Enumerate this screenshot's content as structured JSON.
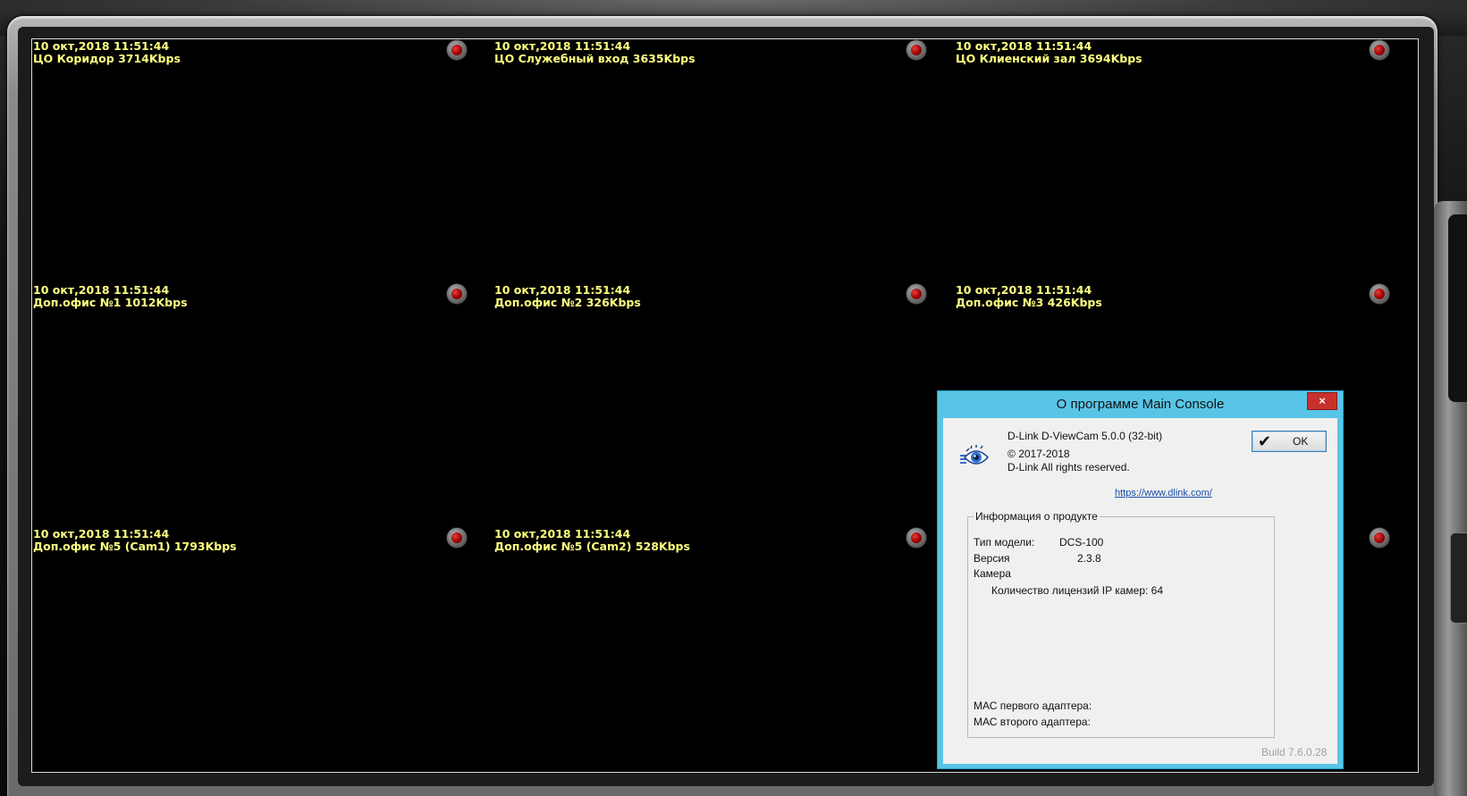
{
  "cameras": [
    {
      "datetime": "10 окт,2018 11:51:44",
      "name": "ЦО Коридор 3714Kbps"
    },
    {
      "datetime": "10 окт,2018 11:51:44",
      "name": "ЦО Служебный вход 3635Kbps"
    },
    {
      "datetime": "10 окт,2018 11:51:44",
      "name": "ЦО Клиенский зал 3694Kbps"
    },
    {
      "datetime": "10 окт,2018 11:51:44",
      "name": "Доп.офис №1 1012Kbps"
    },
    {
      "datetime": "10 окт,2018 11:51:44",
      "name": "Доп.офис №2 326Kbps"
    },
    {
      "datetime": "10 окт,2018 11:51:44",
      "name": "Доп.офис №3 426Kbps"
    },
    {
      "datetime": "10 окт,2018 11:51:44",
      "name": "Доп.офис №5 (Cam1) 1793Kbps"
    },
    {
      "datetime": "10 окт,2018 11:51:44",
      "name": "Доп.офис №5 (Cam2) 528Kbps"
    },
    {
      "datetime": "",
      "name": ""
    }
  ],
  "colors": {
    "overlay_text": "#ffff80",
    "dialog_frame": "#59c5e6",
    "close_button": "#c9302c",
    "link": "#1a4fa8"
  },
  "dialog": {
    "title": "О программе Main Console",
    "close_label": "×",
    "product": "D-Link D-ViewCam 5.0.0 (32-bit)",
    "copyright_symbol": "©",
    "copyright": "2017-2018",
    "rights": "D-Link All rights reserved.",
    "ok_label": "OK",
    "link": "https://www.dlink.com/",
    "group_title": "Информация о продукте",
    "model_label": "Тип модели:",
    "model_value": "DCS-100",
    "version_label": "Версия",
    "version_value": "2.3.8",
    "camera_label": "Камера",
    "license_text": "Количество лицензий IP камер: 64",
    "mac1_label": "МАС первого адаптера:",
    "mac2_label": "МАС второго адаптера:",
    "build": "Build 7.6.0.28"
  }
}
